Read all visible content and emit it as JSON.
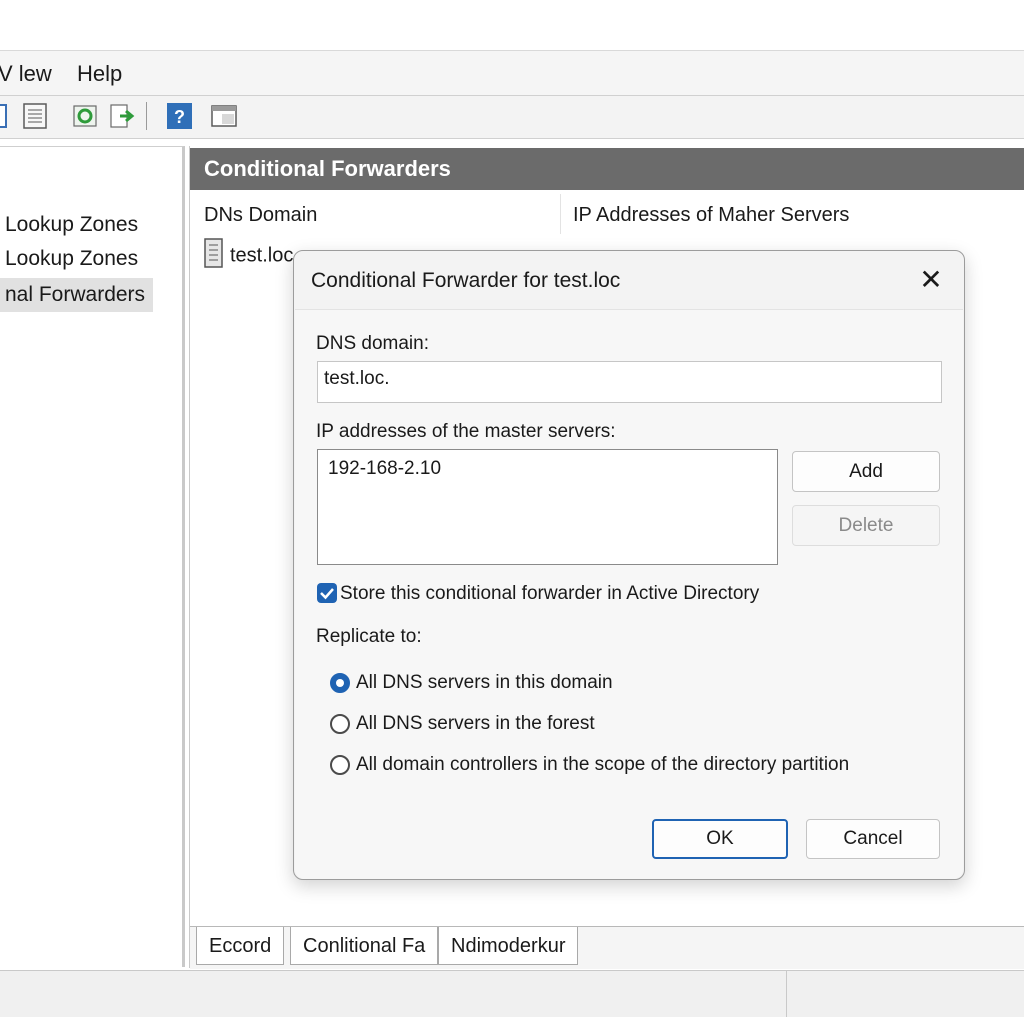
{
  "menubar": {
    "items": [
      "V lew",
      "Help"
    ]
  },
  "toolbar": {
    "icons": [
      "back-icon",
      "properties-icon",
      "refresh-icon",
      "export-icon",
      "help-icon",
      "console-icon"
    ]
  },
  "tree": {
    "items": [
      {
        "label": "Lookup Zones"
      },
      {
        "label": "Lookup Zones"
      },
      {
        "label": "nal Forwarders",
        "selected": true
      }
    ]
  },
  "content": {
    "title": "Conditional Forwarders",
    "columns": [
      "DNs Domain",
      "IP Addresses of Maher Servers"
    ],
    "rows": [
      {
        "domain": "test.loc"
      }
    ],
    "tabs": [
      "Eccord",
      "Conlitional Fa",
      "Ndimoderkur"
    ]
  },
  "dialog": {
    "title": "Conditional Forwarder for test.loc",
    "dns_domain_label": "DNS domain:",
    "dns_domain_value": "test.loc.",
    "ip_label": "IP addresses of the master servers:",
    "ip_values": [
      "192-168-2.10"
    ],
    "add_label": "Add",
    "delete_label": "Delete",
    "store_label": "Store this conditional  forwarder in Active Directory",
    "store_checked": true,
    "replicate_label": "Replicate to:",
    "replicate_options": [
      "All DNS servers in this domain",
      "All DNS servers in the forest",
      "All domain controllers in the scope of the directory partition"
    ],
    "replicate_selected": 0,
    "ok_label": "OK",
    "cancel_label": "Cancel"
  },
  "colors": {
    "accent": "#1f63b3",
    "header_bg": "#6b6b6b"
  }
}
